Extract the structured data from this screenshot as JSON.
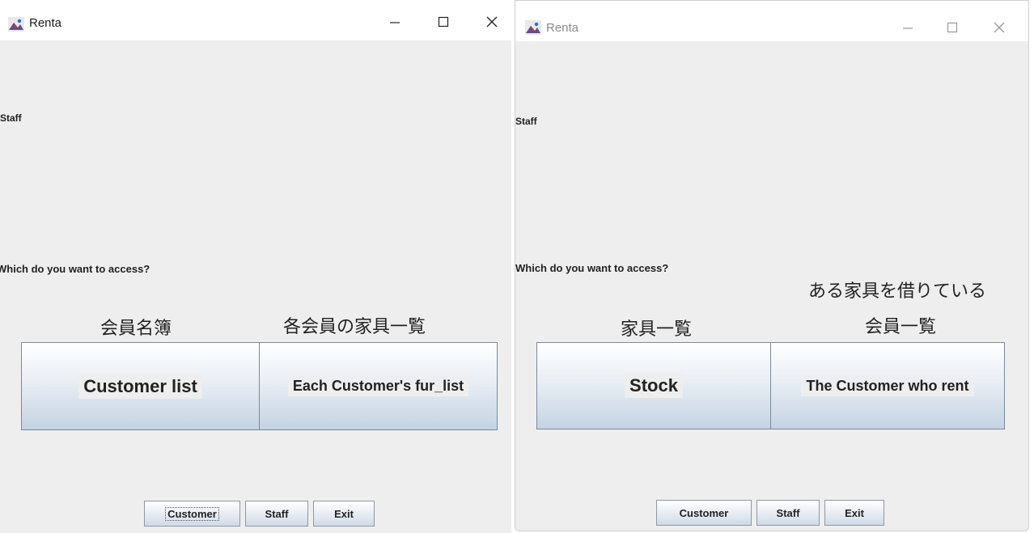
{
  "left_window": {
    "title": "Renta",
    "staff_label": "Staff",
    "question": "Which do you want to access?",
    "annotations": [
      "会員名簿",
      "各会員の家具一覧"
    ],
    "main_buttons": [
      "Customer list",
      "Each Customer's fur_list"
    ],
    "footer_buttons": {
      "customer": "Customer",
      "staff": "Staff",
      "exit": "Exit"
    }
  },
  "right_window": {
    "title": "Renta",
    "staff_label": "Staff",
    "question": "Which do you want to access?",
    "annotations": [
      "家具一覧",
      "ある家具を借りている",
      "会員一覧"
    ],
    "main_buttons": [
      "Stock",
      "The Customer who rent"
    ],
    "footer_buttons": {
      "customer": "Customer",
      "staff": "Staff",
      "exit": "Exit"
    }
  },
  "icons": {
    "app": "app-icon",
    "minimize": "minimize-icon",
    "maximize": "maximize-icon",
    "close": "close-icon"
  },
  "colors": {
    "window_bg": "#eeeeee",
    "titlebar_bg": "#ffffff",
    "button_gradient_bottom": "#c4d3e2",
    "button_border": "#7a8a9a"
  }
}
